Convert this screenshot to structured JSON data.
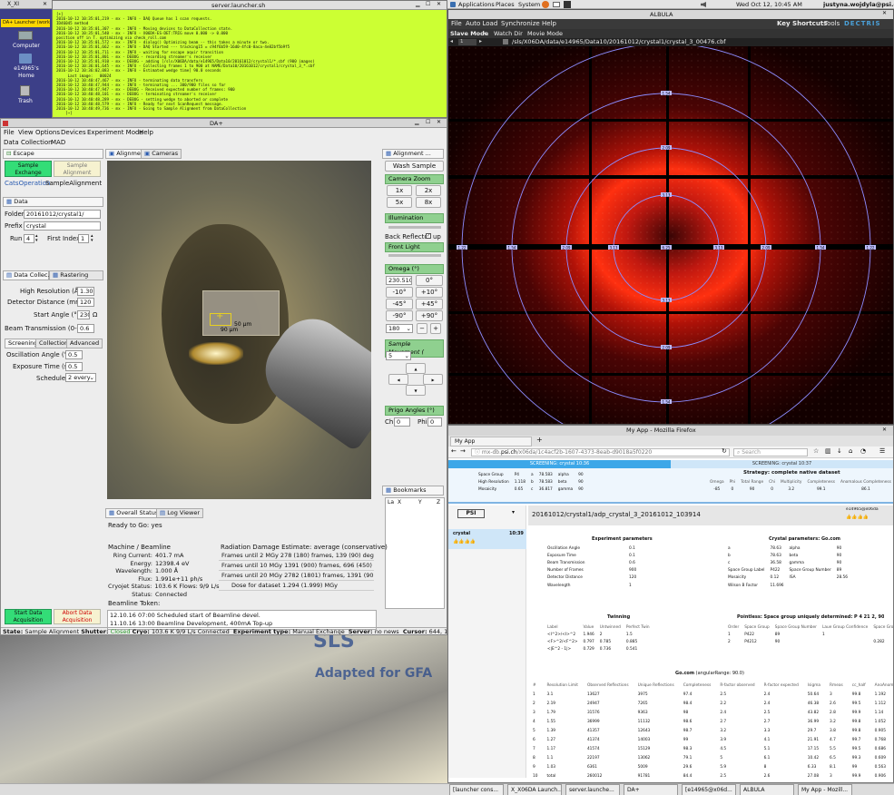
{
  "topbar": {
    "menus": [
      "Applications",
      "Places",
      "System"
    ],
    "clock": "Wed Oct 12, 10:45 AM",
    "user": "justyna.wojdyla@psi.ch"
  },
  "desktop": {
    "tab_label": "X_XI",
    "launcher_label": "DA+ Launcher (work)",
    "icons": [
      "Computer",
      "e14965's Home",
      "Trash"
    ],
    "wallpaper_text": [
      "SLS",
      "Adapted for GFA"
    ]
  },
  "terminal": {
    "title": "server.launcher.sh",
    "lines": [
      "[+]",
      "2016-10-12 10:35:01,219 - mx - INFO - DAQ Queue has 1 scan requests.",
      "ID46045 method",
      "2016-10-12 10:35:01,307 - mx - INFO - Moving devices to DataCollection state.",
      "2016-10-12 10:35:01,540 - mx - INFO - X06DA-ES-DET:TRIG move 0.000 -> 0.000",
      "position off in T. optimizing via check_roll.com",
      "2016-10-12 10:35:01,572 - mx - INFO - dialog() Optimizing beam -- this takes a minute or two.",
      "2016-10-12 10:35:01,662 - mx - INFO - DAQ Started --- tracking15 = c94f6b59-16d0-4fc0-8aca-4e82bf5b9f5",
      "2016-10-12 10:35:01,711 - mx - INFO - waiting for escape aquir transition",
      "2016-10-12 10:35:01,801 - mx - DEBUG - recording streamer's receiver",
      "2016-10-12 10:35:01,910 - mx - DEBUG - adding [/sls/X06DA/data/e14965/Data10/20161012/crystal1/*.cbf (900 images)",
      "2016-10-12 10:36:01,645 - mx - INFO - Collecting frames 1 to 900 at NAME/Data10/20161012/crystal1/crystal_3_*.cbf",
      "2016-10-12 10:36:02,083 - mx - INFO - Estimated wedge time] 90.0 seconds",
      "",
      "     Last image:   00024",
      "",
      "2016-10-12 10:40:47,467 - mx - INFO - terminating data transfers",
      "2016-10-12 10:40:47,944 - mx - INFO - terminating ... 300/900 files so far",
      "2016-10-12 10:40:47,947 - mx - DEBUG - Received expected number of frames: 900",
      "2016-10-12 10:40:48,101 - mx - DEBUG - terminating streamer's receiver",
      "2016-10-12 10:40:48,289 - mx - DEBUG - setting wedge to aborted or complete",
      "2016-10-12 10:40:48,579 - mx - INFO - Ready for next ScanRequest message.",
      "2016-10-12 10:40:49,736 - mx - INFO - Going to Sample Alignment from DataCollection",
      "    [~]"
    ]
  },
  "daplus": {
    "title": "DA+",
    "menu": [
      "File",
      "View",
      "Options",
      "Devices",
      "Experiment Mode",
      "Help"
    ],
    "submenu": [
      "Data Collection",
      "MAD"
    ],
    "escape_tab": "Escape",
    "btn_sample_exchange": "Sample Exchange",
    "btn_sample_alignment": "Sample Alignment",
    "cats_operation": "CatsOperation",
    "cats_value": "SampleAlignment",
    "data_tab": "Data",
    "folder_label": "Folder",
    "folder_value": "20161012/crystal1/",
    "prefix_label": "Prefix",
    "prefix_value": "crystal",
    "run_label": "Run",
    "run_value": "4",
    "first_index_label": "First Index",
    "first_index_value": "1",
    "datacol_tab": "Data Collec...",
    "raster_tab": "Rastering",
    "high_res_label": "High Resolution (Å)",
    "high_res_value": "1.307",
    "det_dist_label": "Detector Distance (mm)",
    "det_dist_value": "120",
    "start_angle_label": "Start Angle (°)",
    "start_angle_value": "230",
    "omega_sym": "Ω",
    "beam_trans_label": "Beam Transmission (0-1)",
    "beam_trans_value": "0.6",
    "subtabs": [
      "Screening",
      "Collection",
      "Advanced"
    ],
    "osc_label": "Oscillation Angle (°)",
    "osc_value": "0.5",
    "exp_label": "Exposure Time (s)",
    "exp_value": "0.5",
    "sched_label": "Schedule",
    "sched_value": "2 every",
    "btn_start": "Start Data Acquisition",
    "btn_abort": "Abort Data Acquisition",
    "align_tab": "Alignment",
    "cameras_tab": "Cameras",
    "scale_h": "50 µm",
    "scale_v": "90 µm",
    "right_tab": "Alignment ...",
    "wash_sample": "Wash Sample",
    "camera_zoom": "Camera Zoom",
    "zoom_buttons": [
      "1x",
      "2x",
      "5x",
      "8x"
    ],
    "illumination": "Illumination",
    "back_reflector": "Back Reflector",
    "back_reflector_state": "up",
    "front_light": "Front Light",
    "omega_hdr": "Omega (°)",
    "omega_value": "230.510",
    "omega_buttons": [
      "0°",
      "-10°",
      "+10°",
      "-45°",
      "+45°",
      "-90°",
      "+90°"
    ],
    "omega_step": "180",
    "sample_movement": "Sample Movement (",
    "movement_step": "5",
    "prigo_hdr": "Prigo Angles (°)",
    "chi_label": "Chi",
    "chi_value": "0",
    "phi_label": "Phi",
    "phi_value": "0",
    "bookmarks_tab": "Bookmarks",
    "bookmark_cols": [
      "La",
      "X",
      "Y",
      "Z"
    ],
    "overall_tab": "Overall Status",
    "log_tab": "Log Viewer",
    "ready_text": "Ready to Go: yes",
    "machine_hdr": "Machine / Beamline",
    "machine_rows": [
      {
        "k": "Ring Current:",
        "v": "401.7 mA"
      },
      {
        "k": "Energy:",
        "v": "12398.4 eV"
      },
      {
        "k": "Wavelength:",
        "v": "1.000 Å"
      },
      {
        "k": "Flux:",
        "v": "1.991e+11 ph/s"
      },
      {
        "k": "Cryojet Status:",
        "v": "103.6 K Flows: 9/9 L/s"
      },
      {
        "k": "Status:",
        "v": "Connected"
      }
    ],
    "token_label": "Beamline Token:",
    "rad_hdr": "Radiation Damage Estimate: average (conservative)",
    "rad_rows": [
      "Frames until 2 MGy 278 (180) frames, 139 (90) degrees",
      "Frames until 10 MGy 1391 (900) frames, 696 (450) deg",
      "Frames until 20 MGy 2782 (1801) frames, 1391 (901) d",
      "Dose for dataset 1.294 (1.999) MGy"
    ],
    "news": [
      "12.10.16 07:00 Scheduled start of Beamline devel.",
      "11.10.16 13:00 Beamline Development, 400mA Top-up"
    ],
    "status": {
      "state_label": "State:",
      "state_value": "Sample Alignment",
      "shutter_label": "Shutter:",
      "shutter_value": "Closed",
      "cryo_label": "Cryo:",
      "cryo_value": "103.6 K 9/9 L/s Connected",
      "exp_label": "Experiment type:",
      "exp_value": "Manual Exchange",
      "server_label": "Server:",
      "server_value": "no news",
      "cursor_label": "Cursor:",
      "cursor_value": "644, 1088"
    }
  },
  "albula": {
    "title": "ALBULA",
    "menu": [
      "File",
      "Auto Load",
      "Synchronize",
      "Help"
    ],
    "menu_right": [
      "Key Shortcuts",
      "Tools"
    ],
    "brand": "DECTRIS",
    "toolbar": [
      "Slave Mode",
      "Watch Dir",
      "Movie Mode"
    ],
    "frame": "1",
    "path": "/sls/X06DA/data/e14965/Data10/20161012/crystal1/crystal_3_00476.cbf",
    "ring_labels": [
      "1.22",
      "1.54",
      "2.09",
      "3.13",
      "6.25"
    ]
  },
  "firefox": {
    "title": "My App - Mozilla Firefox",
    "tab": "My App",
    "url_prefix": "mx-db.",
    "url_domain": "psi.ch",
    "url_rest": "/x06da/1c4acf2b-1607-4373-8eab-d9018a5f0220",
    "search_placeholder": "Search",
    "screening_left": "SCREENING: crystal 10:36",
    "screening_right": "SCREENING: crystal 10:37",
    "summary_rows": [
      [
        "Space Group",
        "P4",
        "a",
        "78.583",
        "alpha",
        "90"
      ],
      [
        "High Resolution",
        "1.118",
        "b",
        "78.583",
        "beta",
        "90"
      ],
      [
        "Mosaicity",
        "0.65",
        "c",
        "36.817",
        "gamma",
        "90"
      ]
    ],
    "strategy_title": "Strategy: complete native dataset",
    "strategy_headers": [
      "Omega",
      "Phi",
      "Total Range",
      "Chi",
      "Multiplicity",
      "Completeness",
      "Anomalous Completeness"
    ],
    "strategy_values": [
      "-85",
      "0",
      "90",
      "0",
      "3.2",
      "99.1",
      "86.1"
    ],
    "logo": "PSI",
    "sample_name": "crystal",
    "sample_time": "10:39",
    "dataset_title": "20161012/crystal1/adp_crystal_3_20161012_103914",
    "dataset_user": "e14965@x06da",
    "exp_params_title": "Experiment parameters",
    "exp_params": [
      [
        "Oscillation Angle",
        "0.1"
      ],
      [
        "Exposure Time",
        "0.1"
      ],
      [
        "Beam Transmission",
        "0.6"
      ],
      [
        "Number of Frames",
        "900"
      ],
      [
        "Detector Distance",
        "120"
      ],
      [
        "Wavelength",
        "1"
      ]
    ],
    "crystal_params_title": "Crystal parameters: Go.com",
    "crystal_params": [
      [
        "a",
        "78.63",
        "alpha",
        "90"
      ],
      [
        "b",
        "78.63",
        "beta",
        "90"
      ],
      [
        "c",
        "36.58",
        "gamma",
        "90"
      ],
      [
        "Space Group Label",
        "P422",
        "Space Group Number",
        "89"
      ],
      [
        "Mosaicity",
        "0.12",
        "ISA",
        "28.56"
      ],
      [
        "Wilson B Factor",
        "11.696",
        "",
        ""
      ]
    ],
    "twinning_title": "Twinning",
    "twinning_headers": [
      "Label",
      "Value",
      "Untwinned",
      "Perfect Twin"
    ],
    "twinning_rows": [
      [
        "<I^2>/<I>^2",
        "1.946",
        "2",
        "1.5"
      ],
      [
        "<F>^2/<F^2>",
        "0.797",
        "0.785",
        "0.885"
      ],
      [
        "<|E^2 - 1|>",
        "0.729",
        "0.736",
        "0.541"
      ]
    ],
    "pointless_title": "Pointless: Space group uniquely determined: P 4 21 2, 90",
    "pointless_headers": [
      "Order",
      "Space Group",
      "Space Group Number",
      "Laue Group Confidence",
      "Space Group Confidence"
    ],
    "pointless_rows": [
      [
        "1",
        "P422",
        "89",
        "1",
        ""
      ],
      [
        "2",
        "P4212",
        "90",
        "",
        "0.282"
      ]
    ],
    "gocom_title": "Go.com",
    "gocom_subtitle": "(angularRange: 90.0)",
    "gocom_headers": [
      "#",
      "Resolution Limit",
      "Observed Reflections",
      "Unique Reflections",
      "Completeness",
      "R-factor observed",
      "R-factor expected",
      "Isigma",
      "Rmeas",
      "cc_half",
      "AnoAnom"
    ],
    "gocom_rows": [
      [
        "1",
        "3.1",
        "13627",
        "3975",
        "97.4",
        "2.5",
        "2.4",
        "50.64",
        "3",
        "99.8",
        "1.192"
      ],
      [
        "2",
        "2.19",
        "24947",
        "7265",
        "98.4",
        "2.2",
        "2.4",
        "46.38",
        "2.6",
        "99.5",
        "1.112"
      ],
      [
        "3",
        "1.79",
        "31576",
        "9363",
        "98",
        "2.4",
        "2.5",
        "43.82",
        "2.8",
        "99.9",
        "1.14"
      ],
      [
        "4",
        "1.55",
        "36999",
        "11132",
        "98.6",
        "2.7",
        "2.7",
        "36.99",
        "3.2",
        "99.8",
        "1.052"
      ],
      [
        "5",
        "1.39",
        "41357",
        "12643",
        "98.7",
        "3.2",
        "3.3",
        "29.7",
        "3.8",
        "99.8",
        "0.905"
      ],
      [
        "6",
        "1.27",
        "41374",
        "14003",
        "99",
        "3.9",
        "4.1",
        "21.91",
        "4.7",
        "99.7",
        "0.768"
      ],
      [
        "7",
        "1.17",
        "41574",
        "15129",
        "98.3",
        "4.5",
        "5.1",
        "17.15",
        "5.5",
        "99.5",
        "0.686"
      ],
      [
        "8",
        "1.1",
        "22197",
        "13062",
        "79.1",
        "5",
        "6.1",
        "10.42",
        "6.5",
        "99.3",
        "0.609"
      ],
      [
        "9",
        "1.03",
        "6361",
        "5009",
        "29.6",
        "5.9",
        "8",
        "6.33",
        "8.1",
        "99",
        "0.563"
      ],
      [
        "10",
        "total",
        "260012",
        "91781",
        "84.4",
        "2.5",
        "2.6",
        "27.08",
        "3",
        "99.9",
        "0.906"
      ]
    ]
  },
  "taskbar": [
    "[launcher cons...",
    "X_X06DA Launch...",
    "server.launche...",
    "DA+",
    "[e14965@x06d...",
    "ALBULA",
    "My App - Mozill..."
  ],
  "colors": {
    "terminal_bg": "#ccff33",
    "green_btn": "#33dd77",
    "panel_green": "#3e8e3e",
    "firefox_accent": "#cfe6f8"
  }
}
